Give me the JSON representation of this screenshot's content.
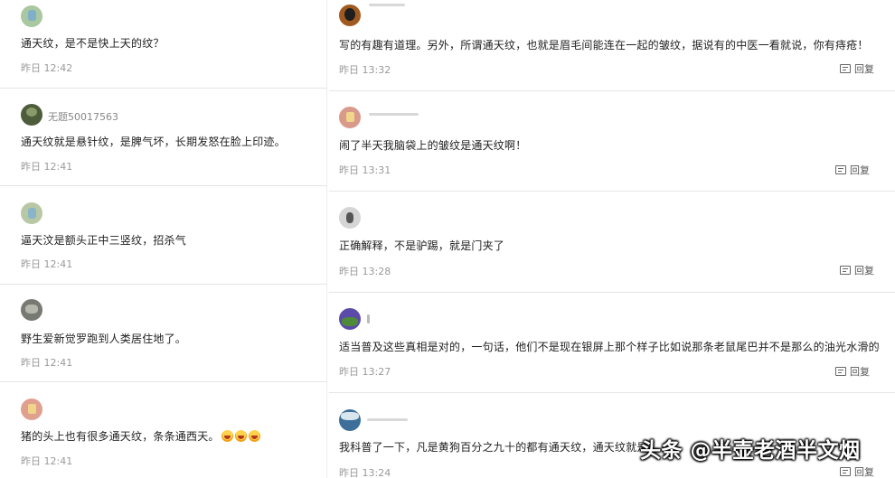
{
  "reply_label": "回复",
  "left_comments": [
    {
      "username": "",
      "text": "通天纹，是不是快上天的纹？",
      "time": "昨日 12:42",
      "avatar_color": "#a9c7a0"
    },
    {
      "username": "无题50017563",
      "text": "通天纹就是悬针纹，是脾气坏，长期发怒在脸上印迹。",
      "time": "昨日 12:41",
      "avatar_color": "#4d5c3b"
    },
    {
      "username": "",
      "text": "逼天汶是额头正中三竖纹，招杀气",
      "time": "昨日 12:41",
      "avatar_color": "#b8c8a5"
    },
    {
      "username": "",
      "text": "野生爱新觉罗跑到人类居住地了。",
      "time": "昨日 12:41",
      "avatar_color": "#777a72"
    },
    {
      "username": "",
      "text": "猪的头上也有很多通天纹，条条通西天。",
      "time": "昨日 12:41",
      "avatar_color": "#e0a090",
      "emoji_count": 3
    }
  ],
  "right_comments": [
    {
      "username": "",
      "text": "写的有趣有道理。另外，所谓通天纹，也就是眉毛间能连在一起的皱纹，据说有的中医一看就说，你有痔疮！",
      "time": "昨日 13:32",
      "avatar_color": "#a05a20"
    },
    {
      "username": "",
      "text": "闹了半天我脑袋上的皱纹是通天纹啊！",
      "time": "昨日 13:31",
      "avatar_color": "#d99a8c"
    },
    {
      "username": "",
      "text": "正确解释，不是驴踢，就是门夹了",
      "time": "昨日 13:28",
      "avatar_color": "#d5d5d5"
    },
    {
      "username": "",
      "text": "适当普及这些真相是对的，一句话，他们不是现在银屏上那个样子比如说那条老鼠尾巴并不是那么的油光水滑的",
      "time": "昨日 13:27",
      "avatar_color": "#5b4aa8"
    },
    {
      "username": "",
      "text": "我科普了一下，凡是黄狗百分之九十的都有通天纹，通天纹就是",
      "time": "昨日 13:24",
      "avatar_color": "#3d6f9a"
    }
  ],
  "watermark": "头条 @半壶老酒半文烟",
  "colors": {
    "text": "#1f1f1f",
    "time": "#9a9a9a",
    "divider": "#e4e4e4"
  },
  "icons": {
    "reply": "comment-reply-icon",
    "emoji": "laughing-face-icon"
  }
}
